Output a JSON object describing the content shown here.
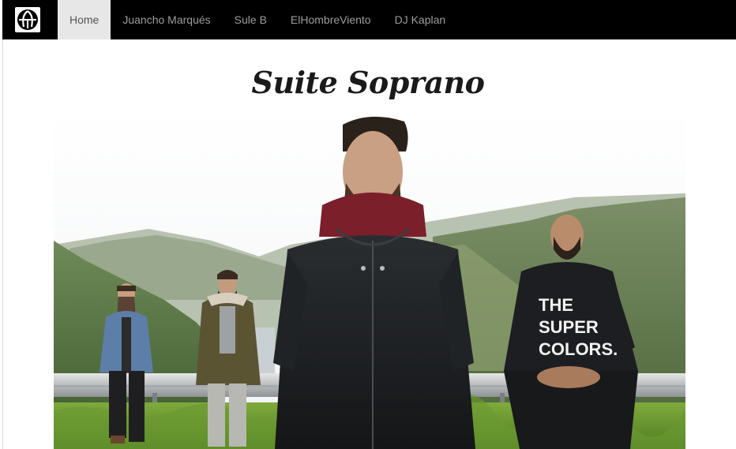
{
  "nav": {
    "logo_icon": "suite-soprano-logo-icon",
    "items": [
      {
        "label": "Home",
        "active": true
      },
      {
        "label": "Juancho Marqués",
        "active": false
      },
      {
        "label": "Sule B",
        "active": false
      },
      {
        "label": "ElHombreViento",
        "active": false
      },
      {
        "label": "DJ Kaplan",
        "active": false
      }
    ]
  },
  "main": {
    "title": "Suite Soprano",
    "hero_image_icon": "band-photo-image",
    "shirt_text": [
      "THE",
      "SUPER",
      "COLORS."
    ]
  },
  "colors": {
    "navbar_bg": "#000000",
    "nav_text": "#9d9d9d",
    "nav_active_bg": "#e7e7e7",
    "nav_active_text": "#555555"
  }
}
